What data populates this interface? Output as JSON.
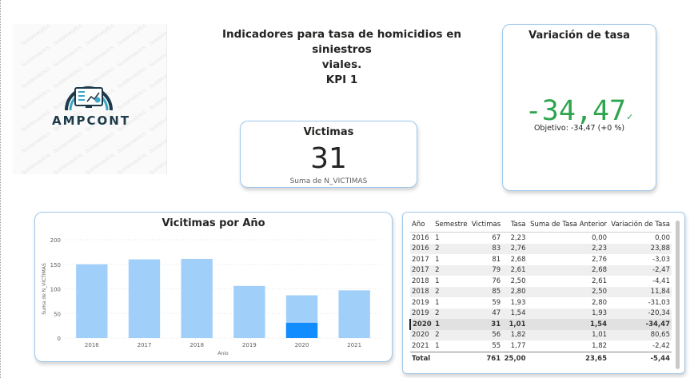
{
  "logo": {
    "text": "AMPCONT",
    "watermark": "Sustainalytics"
  },
  "title": {
    "line1": "Indicadores  para tasa de homicidios en siniestros",
    "line2": "viales.",
    "line3": "KPI 1"
  },
  "victimas_card": {
    "title": "Victimas",
    "value": "31",
    "subtitle": "Suma de N_VICTIMAS"
  },
  "variacion_card": {
    "title": "Variación de tasa",
    "value": "-34,47",
    "goal": "Objetivo: -34,47 (+0 %)",
    "color": "#2ea44f"
  },
  "chart_data": {
    "type": "bar",
    "title": "Vicitimas por Año",
    "xlabel": "Anio",
    "ylabel": "Suma de N_VICTIMAS",
    "categories": [
      "2016",
      "2017",
      "2018",
      "2019",
      "2020",
      "2021"
    ],
    "values": [
      150,
      160,
      161,
      106,
      87,
      97
    ],
    "highlight": {
      "category": "2020",
      "value": 31
    },
    "ylim": [
      0,
      200
    ],
    "yticks": [
      "0",
      "50",
      "100",
      "150",
      "200"
    ],
    "colors": {
      "bar": "#a0cffa",
      "highlight": "#118dff"
    }
  },
  "table": {
    "headers": [
      "Año",
      "Semestre",
      "Victimas",
      "Tasa",
      "Suma de Tasa Anterior",
      "Variación de Tasa"
    ],
    "rows": [
      [
        "2016",
        "1",
        "67",
        "2,23",
        "0,00",
        "0,00"
      ],
      [
        "2016",
        "2",
        "83",
        "2,76",
        "2,23",
        "23,88"
      ],
      [
        "2017",
        "1",
        "81",
        "2,68",
        "2,76",
        "-3,03"
      ],
      [
        "2017",
        "2",
        "79",
        "2,61",
        "2,68",
        "-2,47"
      ],
      [
        "2018",
        "1",
        "76",
        "2,50",
        "2,61",
        "-4,41"
      ],
      [
        "2018",
        "2",
        "85",
        "2,80",
        "2,50",
        "11,84"
      ],
      [
        "2019",
        "1",
        "59",
        "1,93",
        "2,80",
        "-31,03"
      ],
      [
        "2019",
        "2",
        "47",
        "1,54",
        "1,93",
        "-20,34"
      ],
      [
        "2020",
        "1",
        "31",
        "1,01",
        "1,54",
        "-34,47"
      ],
      [
        "2020",
        "2",
        "56",
        "1,82",
        "1,01",
        "80,65"
      ],
      [
        "2021",
        "1",
        "55",
        "1,77",
        "1,82",
        "-2,42"
      ]
    ],
    "selected_row": 8,
    "total": [
      "Total",
      "",
      "761",
      "25,00",
      "23,65",
      "-5,44"
    ]
  }
}
